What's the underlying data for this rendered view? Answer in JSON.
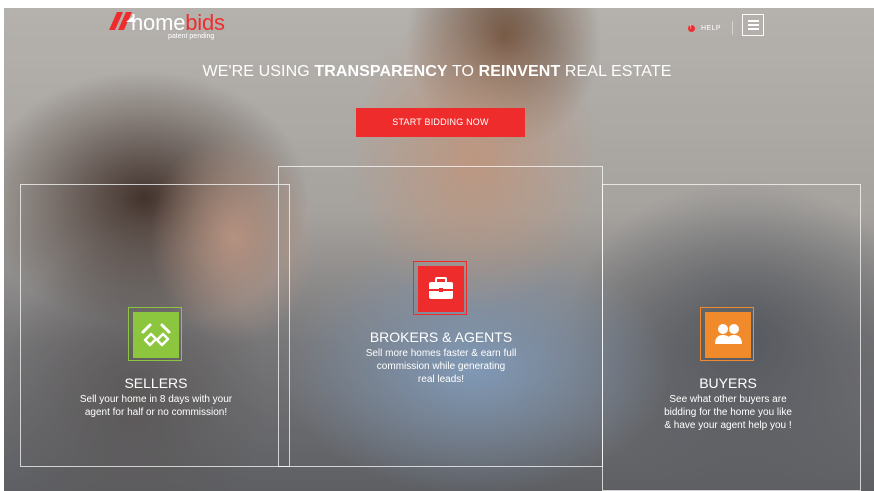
{
  "logo": {
    "wordmark_primary": "home",
    "wordmark_accent": "bids",
    "subtitle": "patent pending",
    "icon": "roof-mark-icon"
  },
  "header": {
    "help_label": "HELP",
    "help_icon": "info-dot-icon",
    "menu_icon": "hamburger-menu-icon"
  },
  "hero": {
    "headline_prefix": "WE'RE USING ",
    "headline_strong_1": "TRANSPARENCY",
    "headline_middle": " TO ",
    "headline_strong_2": "REINVENT",
    "headline_suffix": " REAL ESTATE",
    "cta_label": "START BIDDING NOW"
  },
  "features": [
    {
      "title": "SELLERS",
      "text": "Sell your home in 8 days with your\nagent for half or no commission!",
      "icon": "handshake-icon"
    },
    {
      "title": "BROKERS & AGENTS",
      "text": "Sell more homes faster & earn full\ncommission while generating\nreal leads!",
      "icon": "briefcase-icon"
    },
    {
      "title": "BUYERS",
      "text": "See what other buyers are\nbidding for the home you like\n& have your agent help you !",
      "icon": "buyers-group-icon"
    }
  ],
  "colors": {
    "brand_red": "#ef2c2c",
    "seller_green": "#8cc63f",
    "buyer_orange": "#f08a2a",
    "text_white": "#ffffff"
  }
}
